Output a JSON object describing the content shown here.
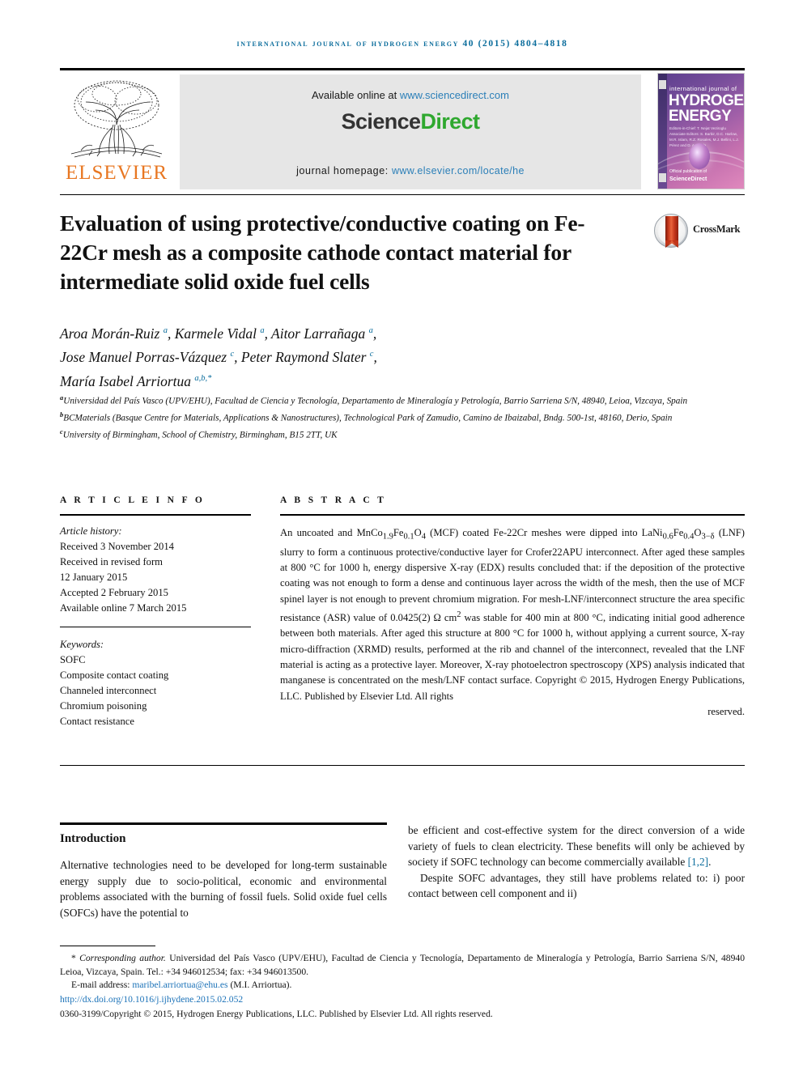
{
  "running_head": "international journal of hydrogen energy 40 (2015) 4804–4818",
  "masthead": {
    "publisher_name": "ELSEVIER",
    "available_prefix": "Available online at ",
    "available_link": "www.sciencedirect.com",
    "brand_part1": "Science",
    "brand_part2": "Direct",
    "homepage_label": "journal homepage: ",
    "homepage_link": "www.elsevier.com/locate/he",
    "cover": {
      "line1": "international journal of",
      "head1": "HYDROGEN",
      "head2": "ENERGY",
      "editors": "Editors-in-Chief: T. Nejat Veziroglu\nAssociate Editors: S. Barbir, D.C. Harlow, M.R. Islam, R.Z. Rosales, M.J. Bellini, L.J. Pérez and D. Andrade",
      "footer": "Official publication of",
      "footer_brand": "ScienceDirect"
    }
  },
  "article": {
    "title": "Evaluation of using protective/conductive coating on Fe-22Cr mesh as a composite cathode contact material for intermediate solid oxide fuel cells",
    "crossmark_label": "CrossMark",
    "authors_line1_a": "Aroa Morán-Ruiz ",
    "authors_line1_sup1": "a",
    "authors_line1_b": ", Karmele Vidal ",
    "authors_line1_sup2": "a",
    "authors_line1_c": ", Aitor Larrañaga ",
    "authors_line1_sup3": "a",
    "authors_line1_d": ",",
    "authors_line2_a": "Jose Manuel Porras-Vázquez ",
    "authors_line2_sup1": "c",
    "authors_line2_b": ", Peter Raymond Slater ",
    "authors_line2_sup2": "c",
    "authors_line2_c": ",",
    "authors_line3_a": "María Isabel Arriortua ",
    "authors_line3_sup1": "a,b,*",
    "affiliations": [
      {
        "mark": "a",
        "text": "Universidad del País Vasco (UPV/EHU), Facultad de Ciencia y Tecnología, Departamento de Mineralogía y Petrología, Barrio Sarriena S/N, 48940, Leioa, Vizcaya, Spain"
      },
      {
        "mark": "b",
        "text": "BCMaterials (Basque Centre for Materials, Applications & Nanostructures), Technological Park of Zamudio, Camino de Ibaizabal, Bndg. 500-1st, 48160, Derio, Spain"
      },
      {
        "mark": "c",
        "text": "University of Birmingham, School of Chemistry, Birmingham, B15 2TT, UK"
      }
    ]
  },
  "article_info": {
    "heading": "A R T I C L E  I N F O",
    "history_label": "Article history:",
    "history": [
      "Received 3 November 2014",
      "Received in revised form",
      "12 January 2015",
      "Accepted 2 February 2015",
      "Available online 7 March 2015"
    ],
    "keywords_label": "Keywords:",
    "keywords": [
      "SOFC",
      "Composite contact coating",
      "Channeled interconnect",
      "Chromium poisoning",
      "Contact resistance"
    ]
  },
  "abstract": {
    "heading": "A B S T R A C T",
    "text_part1": "An uncoated and MnCo",
    "f1_sub1": "1.9",
    "f1_mid": "Fe",
    "f1_sub2": "0.1",
    "f1_o": "O",
    "f1_sub3": "4",
    "text_part2": " (MCF) coated Fe-22Cr meshes were dipped into LaNi",
    "f2_sub1": "0.6",
    "f2_mid": "Fe",
    "f2_sub2": "0.4",
    "f2_o": "O",
    "f2_sub3": "3−δ",
    "text_part3": " (LNF) slurry to form a continuous protective/conductive layer for Crofer22APU interconnect. After aged these samples at 800 °C for 1000 h, energy dispersive X-ray (EDX) results concluded that: if the deposition of the protective coating was not enough to form a dense and continuous layer across the width of the mesh, then the use of MCF spinel layer is not enough to prevent chromium migration. For mesh-LNF/interconnect structure the area specific resistance (ASR) value of 0.0425(2) Ω cm",
    "sup_cm2": "2",
    "text_part4": " was stable for 400 min at 800 °C, indicating initial good adherence between both materials. After aged this structure at 800 °C for 1000 h, without applying a current source, X-ray micro-diffraction (XRMD) results, performed at the rib and channel of the interconnect, revealed that the LNF material is acting as a protective layer. Moreover, X-ray photoelectron spectroscopy (XPS) analysis indicated that manganese is concentrated on the mesh/LNF contact surface.",
    "copyright": "Copyright © 2015, Hydrogen Energy Publications, LLC. Published by Elsevier Ltd. All rights",
    "copyright_last": "reserved."
  },
  "introduction": {
    "heading": "Introduction",
    "left_para1": "Alternative technologies need to be developed for long-term sustainable energy supply due to socio-political, economic and environmental problems associated with the burning of fossil fuels. Solid oxide fuel cells (SOFCs) have the potential to",
    "right_para1_a": "be efficient and cost-effective system for the direct conversion of a wide variety of fuels to clean electricity. These benefits will only be achieved by society if SOFC technology can become commercially available ",
    "right_para1_cite": "[1,2]",
    "right_para1_b": ".",
    "right_para2": "Despite SOFC advantages, they still have problems related to: i) poor contact between cell component and ii)"
  },
  "footer": {
    "corr_mark": "*",
    "corr_label": "Corresponding author.",
    "corr_text": " Universidad del País Vasco (UPV/EHU), Facultad de Ciencia y Tecnología, Departamento de Mineralogía y Petrología, Barrio Sarriena S/N, 48940 Leioa, Vizcaya, Spain. Tel.: +34 946012534; fax: +34 946013500.",
    "email_label": "E-mail address: ",
    "email": "maribel.arriortua@ehu.es",
    "email_suffix": " (M.I. Arriortua).",
    "doi": "http://dx.doi.org/10.1016/j.ijhydene.2015.02.052",
    "issn_line": "0360-3199/Copyright © 2015, Hydrogen Energy Publications, LLC. Published by Elsevier Ltd. All rights reserved."
  }
}
